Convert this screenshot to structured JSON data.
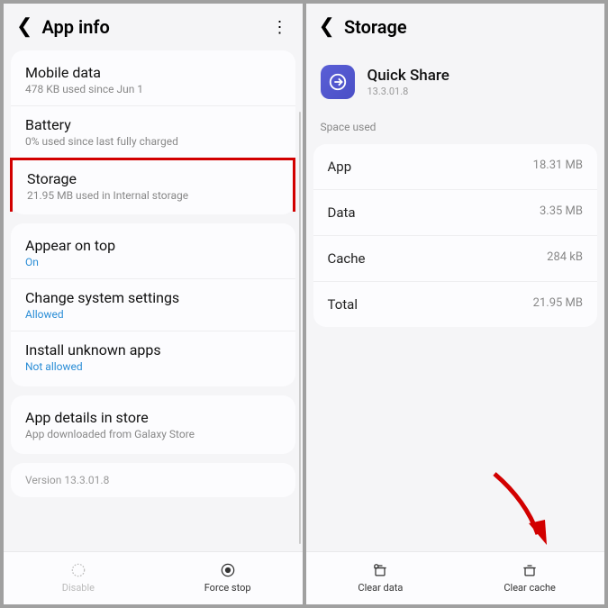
{
  "left": {
    "header_title": "App info",
    "rows": {
      "mobile_data": {
        "title": "Mobile data",
        "sub": "478 KB used since Jun 1"
      },
      "battery": {
        "title": "Battery",
        "sub": "0% used since last fully charged"
      },
      "storage": {
        "title": "Storage",
        "sub": "21.95 MB used in Internal storage"
      },
      "appear": {
        "title": "Appear on top",
        "sub": "On"
      },
      "change": {
        "title": "Change system settings",
        "sub": "Allowed"
      },
      "install": {
        "title": "Install unknown apps",
        "sub": "Not allowed"
      },
      "details": {
        "title": "App details in store",
        "sub": "App downloaded from Galaxy Store"
      }
    },
    "version": "Version 13.3.01.8",
    "bottom": {
      "disable": "Disable",
      "force_stop": "Force stop"
    }
  },
  "right": {
    "header_title": "Storage",
    "app_name": "Quick Share",
    "app_version": "13.3.01.8",
    "space_used_label": "Space used",
    "stats": {
      "app": {
        "label": "App",
        "value": "18.31 MB"
      },
      "data": {
        "label": "Data",
        "value": "3.35 MB"
      },
      "cache": {
        "label": "Cache",
        "value": "284 kB"
      },
      "total": {
        "label": "Total",
        "value": "21.95 MB"
      }
    },
    "bottom": {
      "clear_data": "Clear data",
      "clear_cache": "Clear cache"
    }
  }
}
